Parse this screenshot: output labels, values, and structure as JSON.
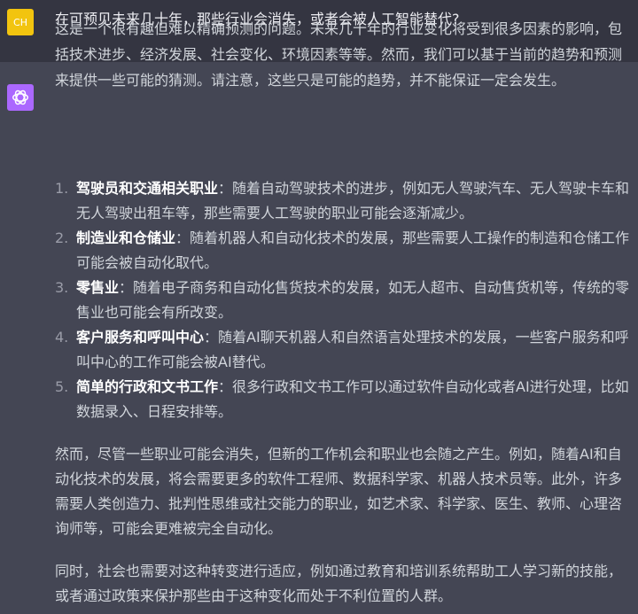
{
  "user": {
    "avatar": "CH",
    "question": "在可预见未来几十年，那些行业会消失，或者会被人工智能替代?"
  },
  "assistant": {
    "intro": [
      "这是一个很有趣但难以精确预测的问题。未来几十年的行业变化将受到很多因素的影响，包",
      "括技术进步、经济发展、社会变化、环境因素等等。然而，我们可以基于当前的趋势和预测",
      "来提供一些可能的猜测。请注意，这些只是可能的趋势，并不能保证一定会发生。"
    ],
    "items": [
      {
        "num": "1.",
        "title": "驾驶员和交通相关职业",
        "line1": "：随着自动驾驶技术的进步，例如无人驾驶汽车、无人驾驶卡车和",
        "line2": "无人驾驶出租车等，那些需要人工驾驶的职业可能会逐渐减少。"
      },
      {
        "num": "2.",
        "title": "制造业和仓储业",
        "line1": "：随着机器人和自动化技术的发展，那些需要人工操作的制造和仓储工作",
        "line2": "可能会被自动化取代。"
      },
      {
        "num": "3.",
        "title": "零售业",
        "line1": "：随着电子商务和自动化售货技术的发展，如无人超市、自动售货机等，传统的零",
        "line2": "售业也可能会有所改变。"
      },
      {
        "num": "4.",
        "title": "客户服务和呼叫中心",
        "line1": "：随着AI聊天机器人和自然语言处理技术的发展，一些客户服务和呼",
        "line2": "叫中心的工作可能会被AI替代。"
      },
      {
        "num": "5.",
        "title": "简单的行政和文书工作",
        "line1": "：很多行政和文书工作可以通过软件自动化或者AI进行处理，比如",
        "line2": "数据录入、日程安排等。"
      }
    ],
    "para2": [
      "然而，尽管一些职业可能会消失，但新的工作机会和职业也会随之产生。例如，随着AI和自",
      "动化技术的发展，将会需要更多的软件工程师、数据科学家、机器人技术员等。此外，许多",
      "需要人类创造力、批判性思维或社交能力的职业，如艺术家、科学家、医生、教师、心理咨",
      "询师等，可能会更难被完全自动化。"
    ],
    "para3": [
      "同时，社会也需要对这种转变进行适应，例如通过教育和培训系统帮助工人学习新的技能，",
      "或者通过政策来保护那些由于这种变化而处于不利位置的人群。"
    ]
  }
}
